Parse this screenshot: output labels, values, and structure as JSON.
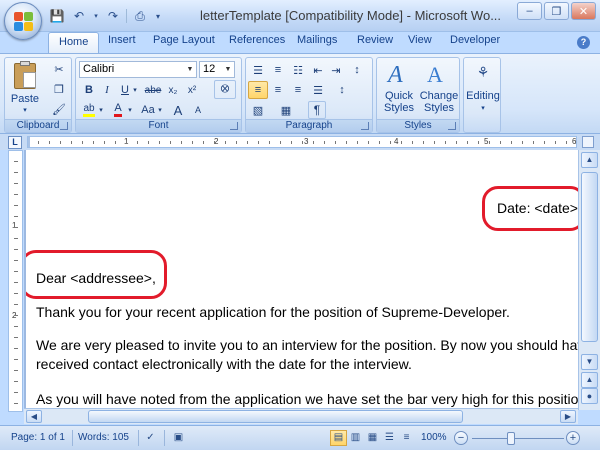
{
  "window": {
    "title": "letterTemplate [Compatibility Mode] - Microsoft Wo..."
  },
  "ribbon_tabs": [
    "Home",
    "Insert",
    "Page Layout",
    "References",
    "Mailings",
    "Review",
    "View",
    "Developer"
  ],
  "font_group": {
    "font_name": "Calibri",
    "font_size": "12"
  },
  "group_labels": {
    "clipboard": "Clipboard",
    "font": "Font",
    "paragraph": "Paragraph",
    "styles": "Styles"
  },
  "buttons": {
    "paste": "Paste",
    "quick_styles": "Quick Styles",
    "change_styles": "Change Styles",
    "editing": "Editing",
    "bold": "B",
    "italic": "I",
    "underline": "U",
    "strike": "abe",
    "subscript": "x₂",
    "superscript": "x²",
    "font_color": "A",
    "change_case": "Aa",
    "grow_font": "A",
    "shrink_font": "A",
    "pilcrow": "¶",
    "highlight": "ab"
  },
  "document": {
    "date_line": "Date: <date>",
    "salutation": "Dear <addressee>,",
    "para1": "Thank you for your recent application for the position of Supreme-Developer.",
    "para2_line1": "We are very pleased to invite you to an interview for the position.  By now you should have",
    "para2_line2": "received contact electronically with the date for the interview.",
    "para3": " As you will have noted from the application we have set the bar very high for this position"
  },
  "ruler": {
    "h_labels": [
      "1",
      "2",
      "3",
      "4",
      "5",
      "6"
    ],
    "v_labels": [
      "1",
      "2"
    ]
  },
  "statusbar": {
    "page": "Page: 1 of 1",
    "words": "Words: 105",
    "zoom": "100%"
  },
  "colors": {
    "annotation_ring": "#e21b2b",
    "ribbon_blue": "#15428b"
  }
}
